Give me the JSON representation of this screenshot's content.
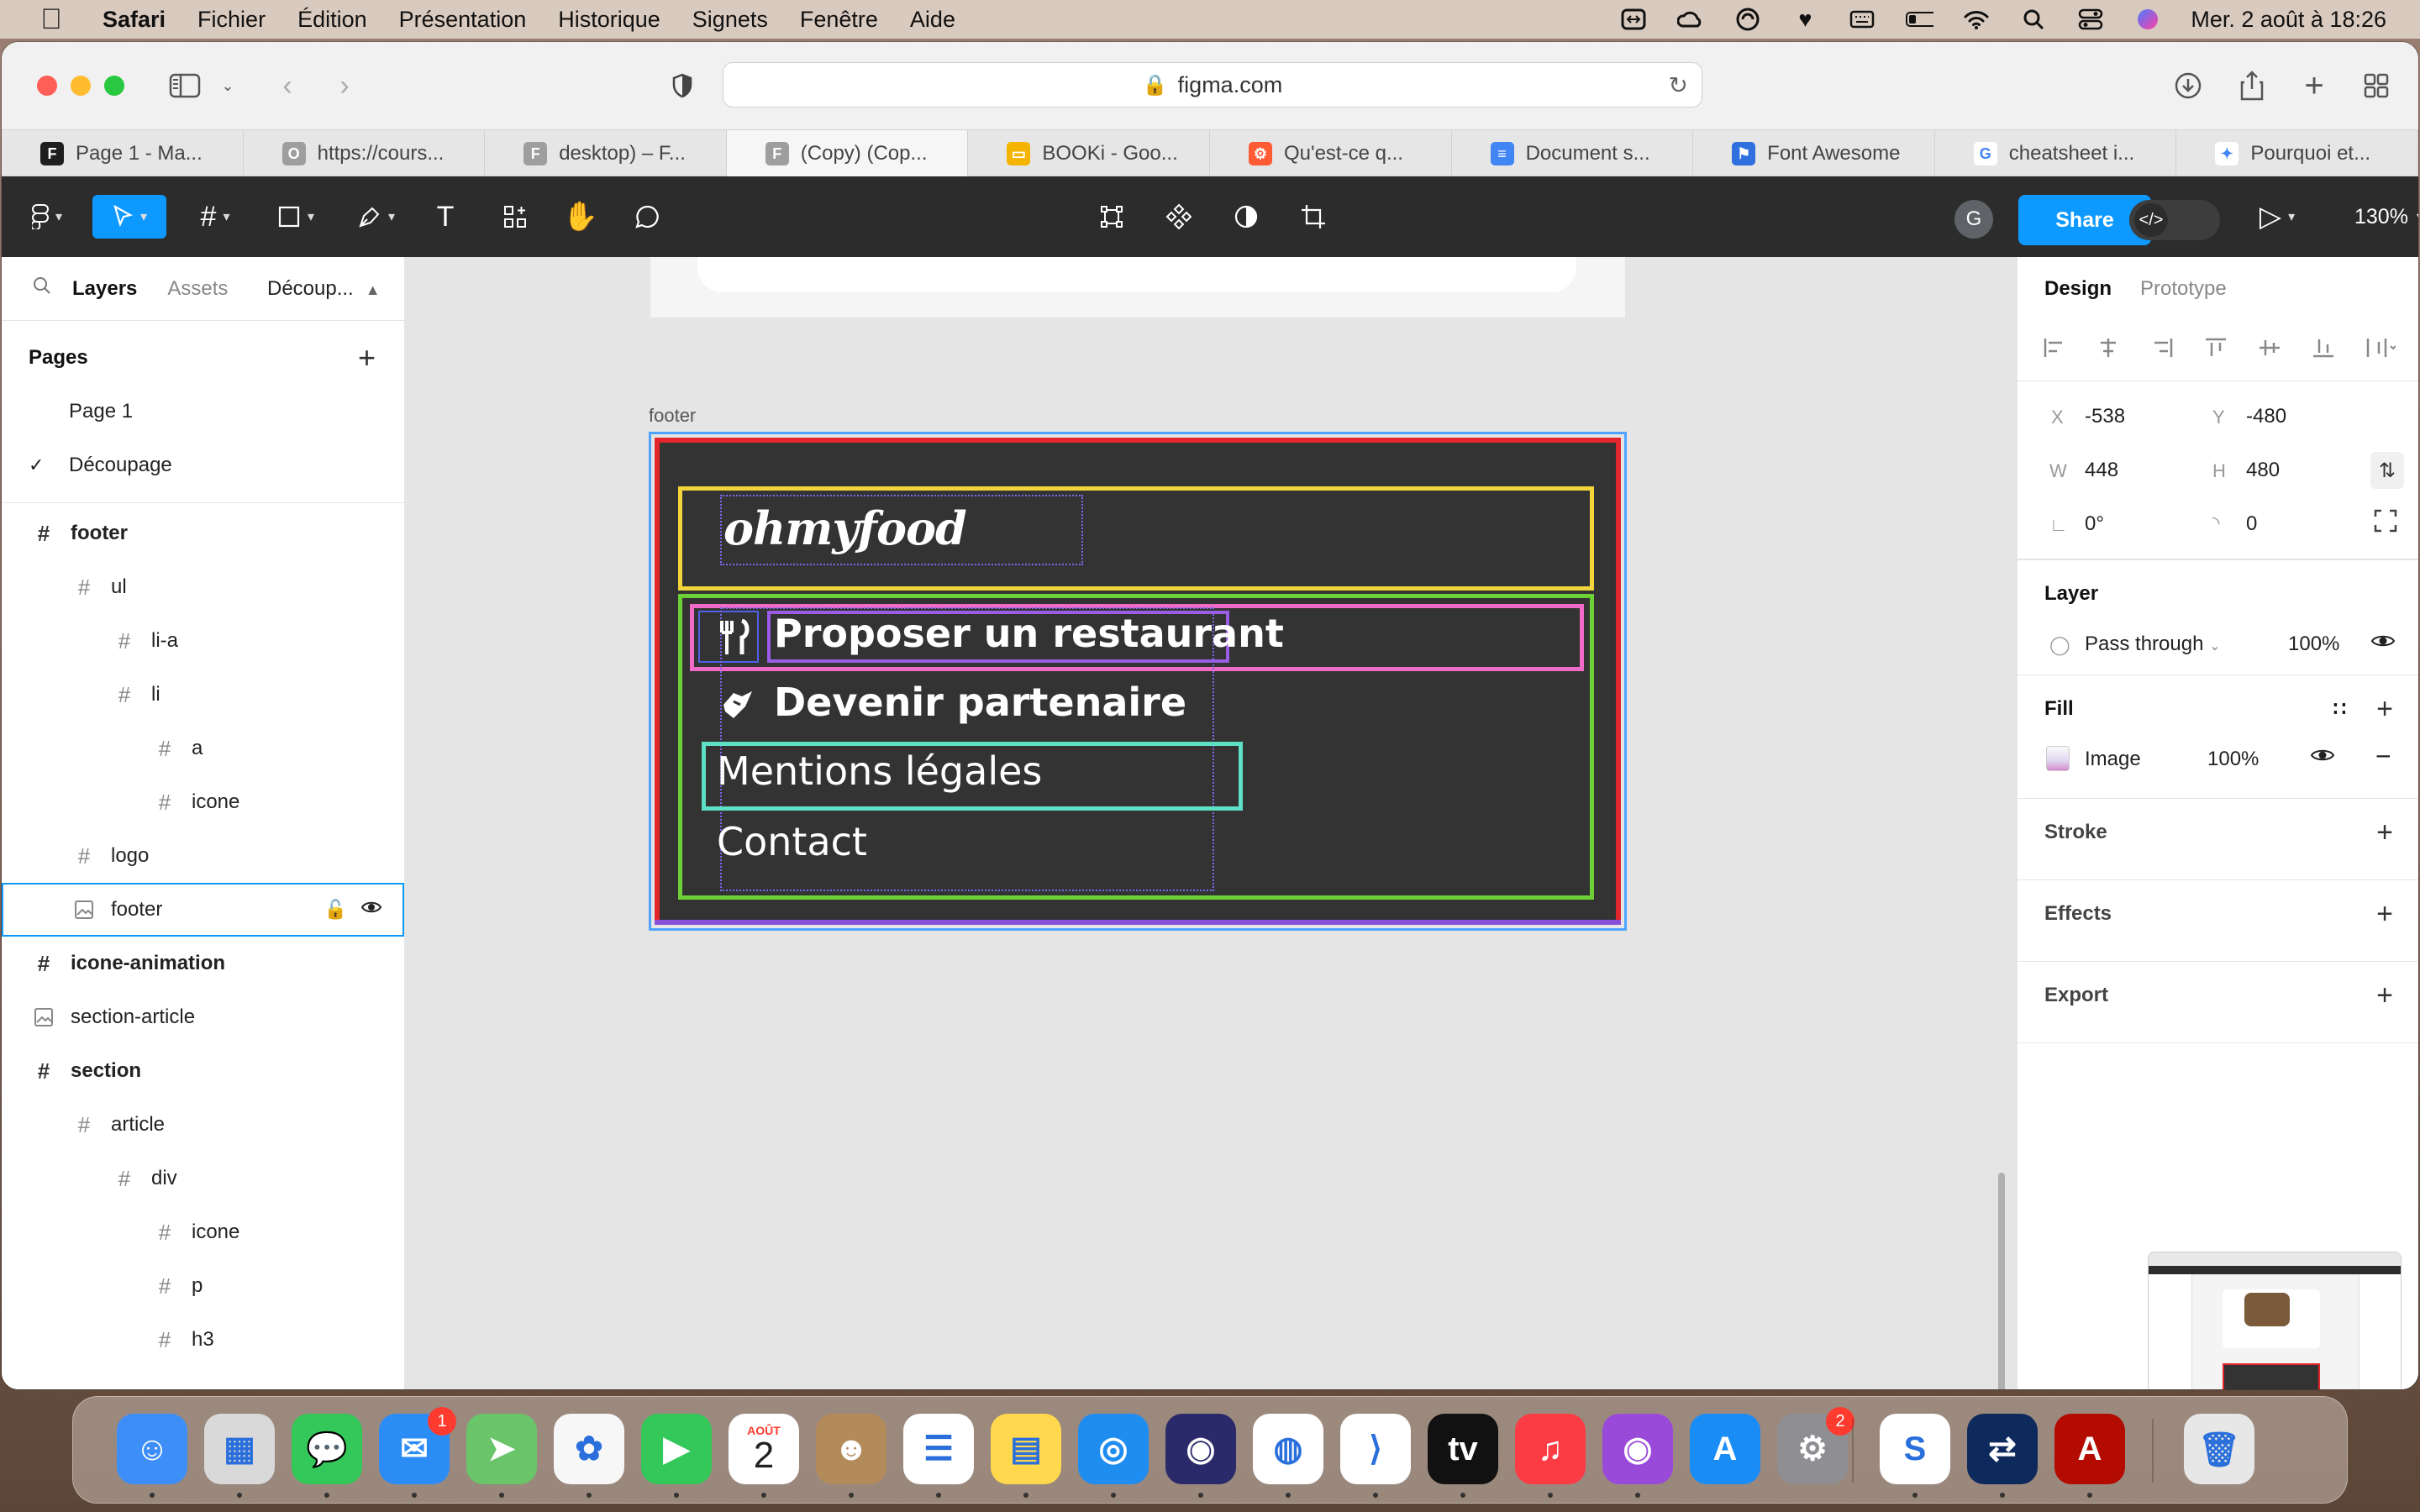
{
  "menubar": {
    "apple": "",
    "app": "Safari",
    "items": [
      "Fichier",
      "Édition",
      "Présentation",
      "Historique",
      "Signets",
      "Fenêtre",
      "Aide"
    ],
    "datetime": "Mer. 2 août à  18:26"
  },
  "browser": {
    "url": "figma.com",
    "tabs": [
      {
        "label": "Page 1 - Ma...",
        "color": "#1e1e1e",
        "glyph": "F"
      },
      {
        "label": "https://cours...",
        "color": "#9e9e9e",
        "glyph": "O"
      },
      {
        "label": "desktop) – F...",
        "color": "#9e9e9e",
        "glyph": "F"
      },
      {
        "label": "(Copy) (Cop...",
        "color": "#9e9e9e",
        "glyph": "F"
      },
      {
        "label": "BOOKi - Goo...",
        "color": "#f4b400",
        "glyph": "▭"
      },
      {
        "label": "Qu'est-ce q...",
        "color": "#ff5c35",
        "glyph": "⚙"
      },
      {
        "label": "Document s...",
        "color": "#4285f4",
        "glyph": "≡"
      },
      {
        "label": "Font Awesome",
        "color": "#2f6fde",
        "glyph": "⚑"
      },
      {
        "label": "cheatsheet i...",
        "color": "#ffffff",
        "glyph": "G"
      },
      {
        "label": "Pourquoi et...",
        "color": "#ffffff",
        "glyph": "✦"
      }
    ]
  },
  "figma": {
    "share_label": "Share",
    "avatar_initial": "G",
    "zoom": "130%",
    "left_tabs": {
      "layers": "Layers",
      "assets": "Assets",
      "page": "Découp..."
    },
    "pages_title": "Pages",
    "pages": [
      "Page 1",
      "Découpage"
    ],
    "layers": [
      {
        "name": "footer",
        "indent": 0,
        "icon": "#",
        "bold": true
      },
      {
        "name": "ul",
        "indent": 1,
        "icon": "#",
        "bold": false
      },
      {
        "name": "li-a",
        "indent": 2,
        "icon": "#",
        "bold": false
      },
      {
        "name": "li",
        "indent": 2,
        "icon": "#",
        "bold": false
      },
      {
        "name": "a",
        "indent": 3,
        "icon": "#",
        "bold": false
      },
      {
        "name": "icone",
        "indent": 3,
        "icon": "#",
        "bold": false
      },
      {
        "name": "logo",
        "indent": 1,
        "icon": "#",
        "bold": false
      },
      {
        "name": "footer",
        "indent": 1,
        "icon": "img",
        "bold": false,
        "selected": true
      },
      {
        "name": "icone-animation",
        "indent": 0,
        "icon": "#",
        "bold": true
      },
      {
        "name": "section-article",
        "indent": 0,
        "icon": "img",
        "bold": false
      },
      {
        "name": "section",
        "indent": 0,
        "icon": "#",
        "bold": true
      },
      {
        "name": "article",
        "indent": 1,
        "icon": "#",
        "bold": false
      },
      {
        "name": "div",
        "indent": 2,
        "icon": "#",
        "bold": false
      },
      {
        "name": "icone",
        "indent": 3,
        "icon": "#",
        "bold": false
      },
      {
        "name": "p",
        "indent": 3,
        "icon": "#",
        "bold": false
      },
      {
        "name": "h3",
        "indent": 3,
        "icon": "#",
        "bold": false
      }
    ],
    "canvas": {
      "frame_label": "footer",
      "logo": "ohmyfood",
      "items": [
        "Proposer un restaurant",
        "Devenir partenaire",
        "Mentions légales",
        "Contact"
      ]
    },
    "right": {
      "tabs": {
        "design": "Design",
        "prototype": "Prototype"
      },
      "props": {
        "x_label": "X",
        "x": "-538",
        "y_label": "Y",
        "y": "-480",
        "w_label": "W",
        "w": "448",
        "h_label": "H",
        "h": "480",
        "rotation": "0°",
        "radius": "0"
      },
      "layer_title": "Layer",
      "blend": "Pass through",
      "opacity": "100%",
      "fill_title": "Fill",
      "fill_type": "Image",
      "fill_opacity": "100%",
      "stroke_title": "Stroke",
      "effects_title": "Effects",
      "export_title": "Export"
    }
  },
  "dock": {
    "calendar_month": "AOÛT",
    "calendar_day": "2",
    "mail_badge": "1",
    "settings_badge": "2",
    "apps": [
      {
        "name": "finder",
        "bg": "#3e8ef7",
        "glyph": "☺"
      },
      {
        "name": "launchpad",
        "bg": "#d9d9d9",
        "glyph": "▦"
      },
      {
        "name": "messages",
        "bg": "#34c759",
        "glyph": "💬"
      },
      {
        "name": "mail",
        "bg": "#2b8cf5",
        "glyph": "✉"
      },
      {
        "name": "maps",
        "bg": "#6ac46a",
        "glyph": "➤"
      },
      {
        "name": "photos",
        "bg": "#f7f7f7",
        "glyph": "✿"
      },
      {
        "name": "facetime",
        "bg": "#34c759",
        "glyph": "▶"
      },
      {
        "name": "calendar",
        "bg": "#ffffff",
        "glyph": ""
      },
      {
        "name": "contacts",
        "bg": "#b38b5a",
        "glyph": "☻"
      },
      {
        "name": "reminders",
        "bg": "#ffffff",
        "glyph": "☰"
      },
      {
        "name": "notes",
        "bg": "#ffd84d",
        "glyph": "▤"
      },
      {
        "name": "safari",
        "bg": "#1f8cf0",
        "glyph": "◎"
      },
      {
        "name": "firefox",
        "bg": "#2a2a6a",
        "glyph": "◉"
      },
      {
        "name": "chrome",
        "bg": "#ffffff",
        "glyph": "◍"
      },
      {
        "name": "vscode",
        "bg": "#ffffff",
        "glyph": "⟩"
      },
      {
        "name": "appletv",
        "bg": "#111111",
        "glyph": "tv"
      },
      {
        "name": "music",
        "bg": "#fc3c44",
        "glyph": "♫"
      },
      {
        "name": "podcasts",
        "bg": "#9a4ad9",
        "glyph": "◉"
      },
      {
        "name": "appstore",
        "bg": "#1a8cf5",
        "glyph": "A"
      },
      {
        "name": "settings",
        "bg": "#8e8e93",
        "glyph": "⚙"
      },
      {
        "name": "skype",
        "bg": "#ffffff",
        "glyph": "S"
      },
      {
        "name": "teamviewer",
        "bg": "#0e2a5c",
        "glyph": "⇄"
      },
      {
        "name": "acrobat",
        "bg": "#b30b00",
        "glyph": "A"
      },
      {
        "name": "trash",
        "bg": "#e7e7e7",
        "glyph": "🗑"
      }
    ]
  }
}
